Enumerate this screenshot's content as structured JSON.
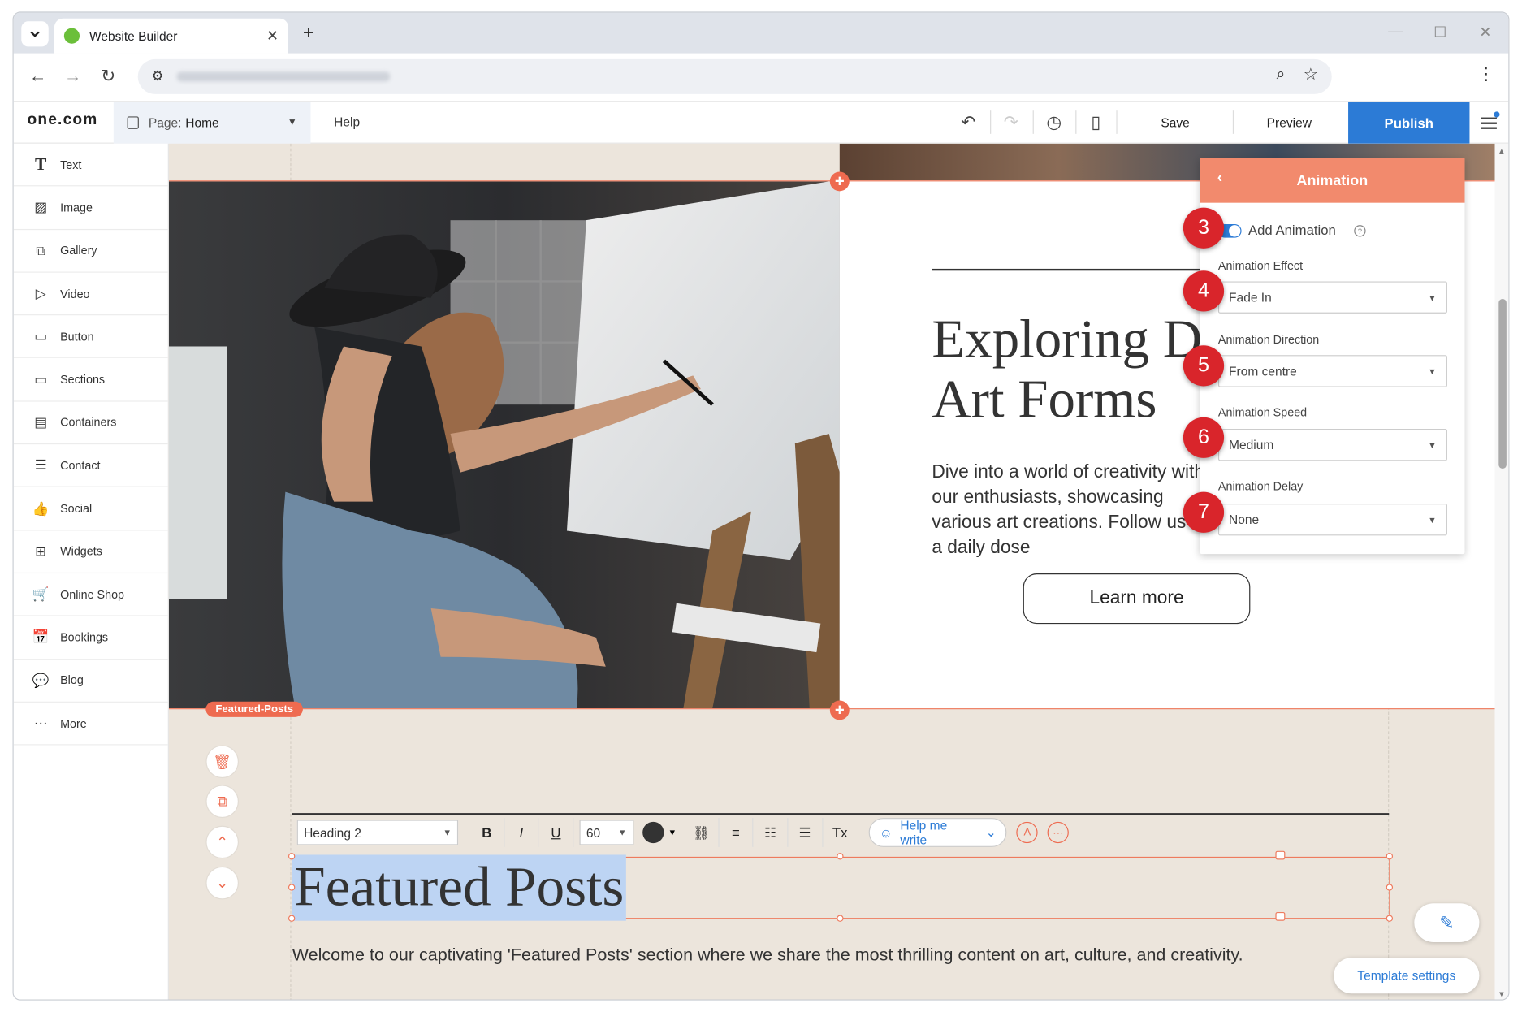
{
  "browser": {
    "tab_title": "Website Builder",
    "new_tab_label": "+",
    "close_label": "✕"
  },
  "app": {
    "logo_prefix": "one",
    "logo_suffix": ".com",
    "page_label": "Page:",
    "page_name": "Home",
    "help": "Help",
    "save": "Save",
    "preview": "Preview",
    "publish": "Publish"
  },
  "sidebar": {
    "items": [
      {
        "label": "Text",
        "icon": "T"
      },
      {
        "label": "Image",
        "icon": "▨"
      },
      {
        "label": "Gallery",
        "icon": "⧉"
      },
      {
        "label": "Video",
        "icon": "▷"
      },
      {
        "label": "Button",
        "icon": "▭"
      },
      {
        "label": "Sections",
        "icon": "▭"
      },
      {
        "label": "Containers",
        "icon": "▤"
      },
      {
        "label": "Contact",
        "icon": "☰"
      },
      {
        "label": "Social",
        "icon": "👍"
      },
      {
        "label": "Widgets",
        "icon": "⊞"
      },
      {
        "label": "Online Shop",
        "icon": "🛒"
      },
      {
        "label": "Bookings",
        "icon": "📅"
      },
      {
        "label": "Blog",
        "icon": "💬"
      },
      {
        "label": "More",
        "icon": "⋯"
      }
    ]
  },
  "hero": {
    "heading": "Exploring D Art Forms",
    "paragraph": "Dive into a world of creativity with our enthusiasts, showcasing various art creations. Follow us for a daily dose",
    "button": "Learn more"
  },
  "section_tag": "Featured-Posts",
  "toolbar": {
    "style": "Heading 2",
    "bold": "B",
    "italic": "I",
    "underline": "U",
    "font_size": "60",
    "clear_format": "Tx",
    "help_me_write": "Help me write"
  },
  "featured": {
    "title": "Featured Posts",
    "text": "Welcome to our captivating 'Featured Posts' section where we share the most thrilling content on art, culture, and creativity."
  },
  "animation_panel": {
    "title": "Animation",
    "toggle_label": "Add Animation",
    "toggle_on": true,
    "effect_label": "Animation Effect",
    "effect_value": "Fade In",
    "direction_label": "Animation Direction",
    "direction_value": "From centre",
    "speed_label": "Animation Speed",
    "speed_value": "Medium",
    "delay_label": "Animation Delay",
    "delay_value": "None"
  },
  "step_badges": [
    "3",
    "4",
    "5",
    "6",
    "7"
  ],
  "template_settings": "Template settings",
  "colors": {
    "accent": "#ee6b50",
    "publish": "#2c7bd6",
    "canvas_bg": "#ece5dc",
    "badge": "#d9252b"
  }
}
